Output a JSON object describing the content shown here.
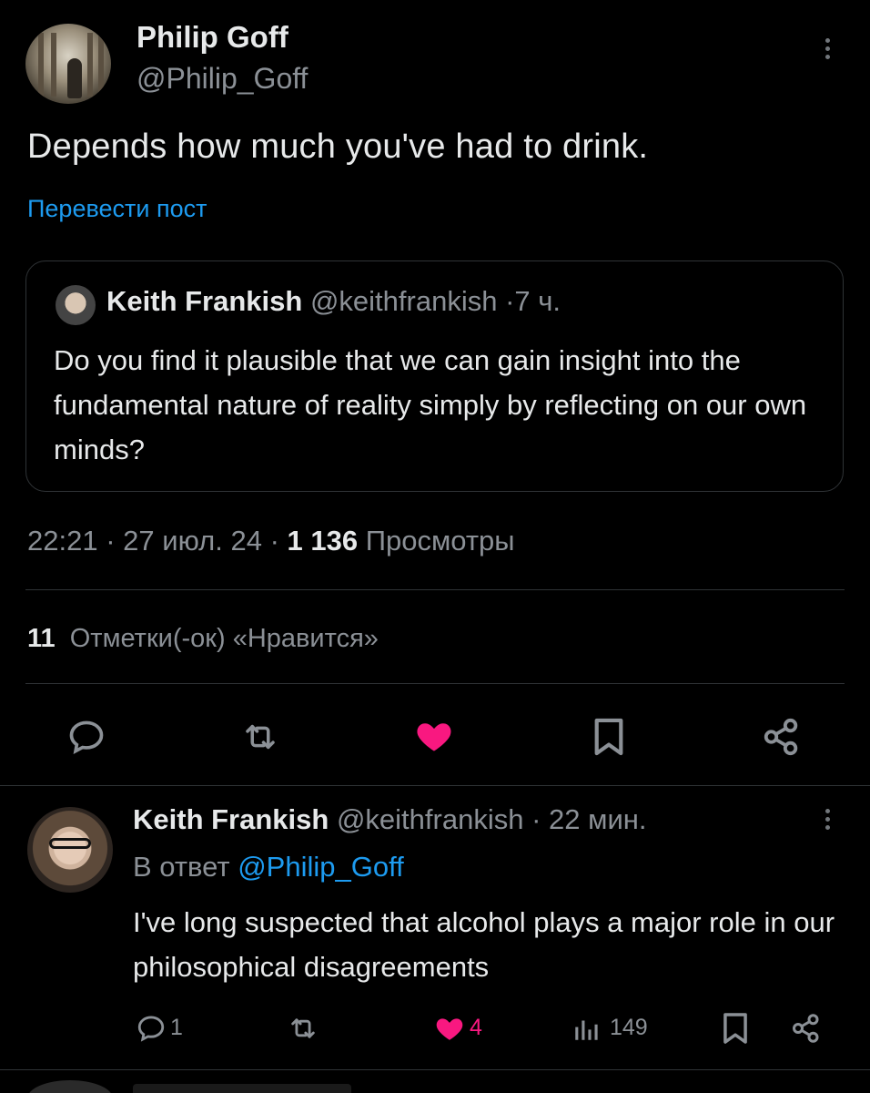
{
  "post": {
    "author_name": "Philip Goff",
    "author_handle": "@Philip_Goff",
    "text": "Depends how much you've had to drink.",
    "translate_label": "Перевести пост",
    "time": "22:21",
    "date": "27 июл. 24",
    "views_count": "1 136",
    "views_label": "Просмотры",
    "likes_count": "11",
    "likes_label": "Отметки(-ок) «Нравится»",
    "liked": true
  },
  "quote": {
    "author_name": "Keith Frankish",
    "author_handle": "@keithfrankish",
    "time": "7 ч.",
    "text": "Do you find it plausible that we can gain insight into the fundamental nature of reality simply by reflecting on our own minds?"
  },
  "reply": {
    "author_name": "Keith Frankish",
    "author_handle": "@keithfrankish",
    "time": "22 мин.",
    "reply_to_label": "В ответ",
    "reply_to_handle": "@Philip_Goff",
    "text": "I've long suspected that alcohol plays a major role in our philosophical disagreements",
    "replies_count": "1",
    "likes_count": "4",
    "views_count": "149",
    "liked": true
  },
  "separator": "·",
  "colors": {
    "background": "#000000",
    "text": "#e7e9ea",
    "muted": "#8b9096",
    "link": "#1d9bf0",
    "like": "#f91880",
    "border": "#2f3336"
  },
  "icons": {
    "more": "more-vertical-icon",
    "reply": "comment-icon",
    "repost": "repost-icon",
    "like": "heart-icon",
    "bookmark": "bookmark-icon",
    "share": "share-icon",
    "views": "bar-chart-icon"
  }
}
